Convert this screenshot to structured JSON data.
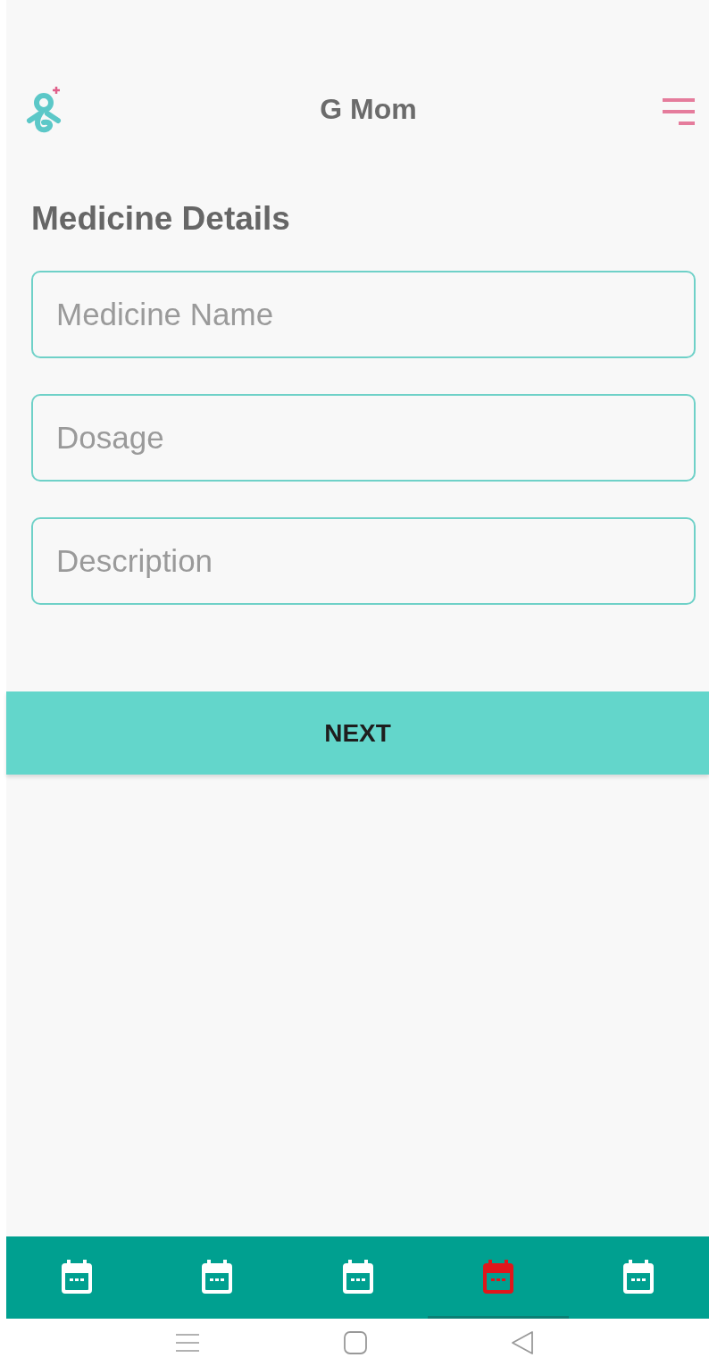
{
  "app_bar": {
    "title": "G Mom"
  },
  "form": {
    "heading": "Medicine Details",
    "fields": [
      {
        "placeholder": "Medicine Name"
      },
      {
        "placeholder": "Dosage"
      },
      {
        "placeholder": "Description"
      }
    ],
    "submit": "NEXT"
  },
  "bottom_nav": [
    {
      "selected": false
    },
    {
      "selected": false
    },
    {
      "selected": false
    },
    {
      "selected": true
    },
    {
      "selected": false
    }
  ]
}
